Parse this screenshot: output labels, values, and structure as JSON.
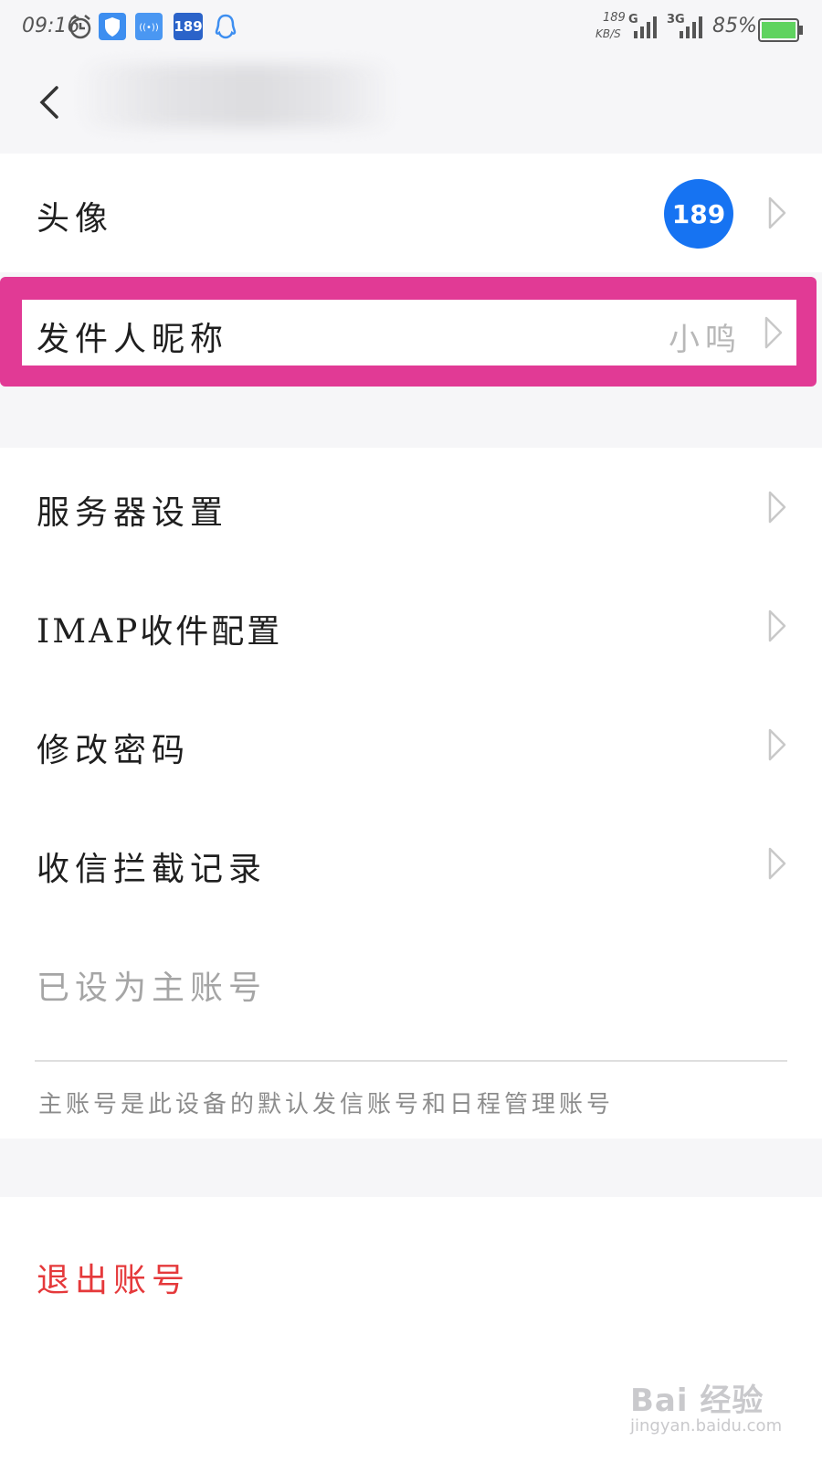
{
  "status_bar": {
    "time": "09:16",
    "speed_value": "189",
    "speed_unit": "KB/S",
    "network_1": "G",
    "network_2": "3G",
    "battery": "85%",
    "app_badge": "189"
  },
  "nav": {
    "back_icon": "chevron-left-icon",
    "title": ""
  },
  "rows": {
    "avatar": {
      "label": "头像",
      "avatar_text": "189"
    },
    "nickname": {
      "label": "发件人昵称",
      "value": "小鸣"
    },
    "server": {
      "label": "服务器设置"
    },
    "imap": {
      "label": "IMAP收件配置"
    },
    "password": {
      "label": "修改密码"
    },
    "blocked": {
      "label": "收信拦截记录"
    },
    "primary": {
      "label": "已设为主账号"
    },
    "primary_note": "主账号是此设备的默认发信账号和日程管理账号",
    "logout": {
      "label": "退出账号"
    }
  },
  "watermark": {
    "brand": "Bai 经验",
    "url": "jingyan.baidu.com"
  },
  "colors": {
    "highlight": "#e13a95",
    "avatar_bg": "#1673f2",
    "logout_text": "#e5393b"
  }
}
